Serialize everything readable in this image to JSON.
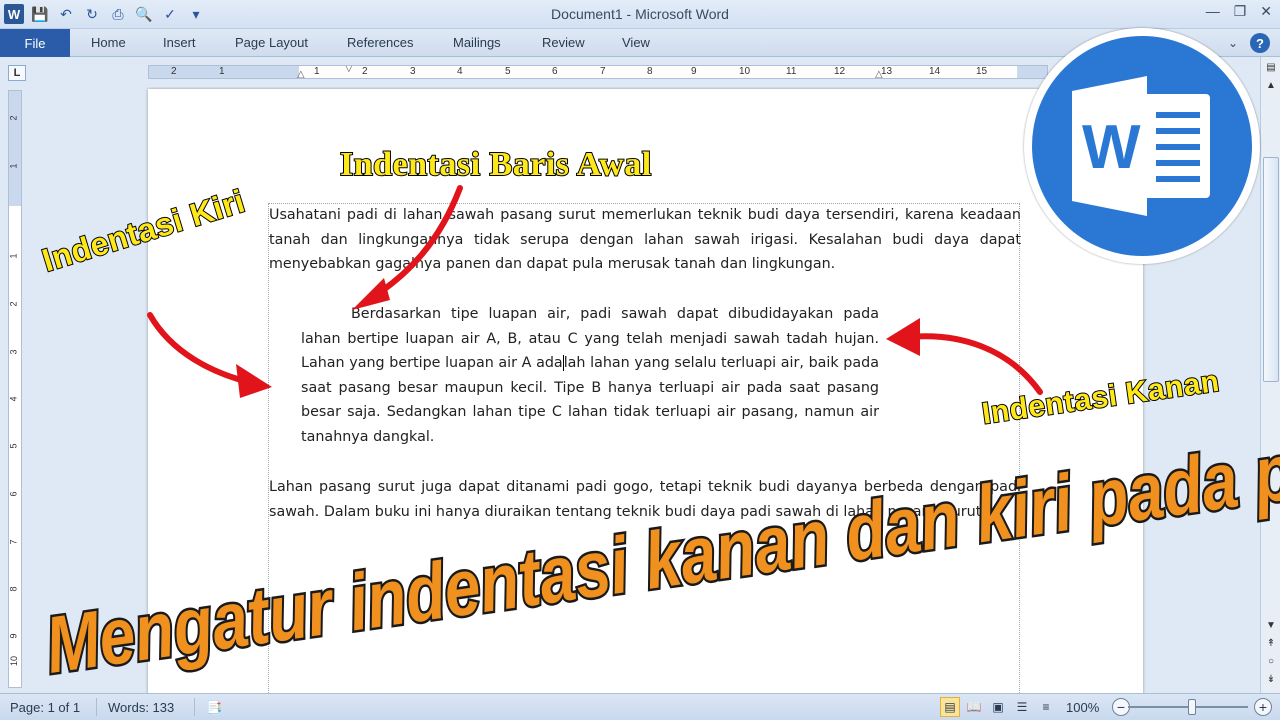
{
  "window": {
    "title": "Document1 - Microsoft Word",
    "app_icon": "W"
  },
  "ribbon": {
    "file": "File",
    "tabs": [
      "Home",
      "Insert",
      "Page Layout",
      "References",
      "Mailings",
      "Review",
      "View"
    ],
    "help": "?"
  },
  "ruler": {
    "tab_selector": "L",
    "h_numbers": [
      "2",
      "1",
      "1",
      "2",
      "3",
      "4",
      "5",
      "6",
      "7",
      "8",
      "9",
      "10",
      "11",
      "12",
      "13",
      "14",
      "15"
    ],
    "v_numbers": [
      "2",
      "1",
      "1",
      "2",
      "3",
      "4",
      "5",
      "6",
      "7",
      "8",
      "9",
      "10"
    ]
  },
  "document": {
    "p1": "Usahatani padi di lahan sawah pasang surut memerlukan teknik budi daya tersendiri, karena keadaan tanah dan lingkungannya tidak serupa dengan lahan sawah irigasi. Kesalahan budi daya dapat menyebabkan gagalnya panen dan dapat pula merusak tanah dan lingkungan.",
    "p2a": "Berdasarkan tipe luapan air, padi sawah dapat dibudidayakan pada lahan bertipe luapan air A, B, atau C yang telah menjadi sawah tadah hujan. Lahan yang bertipe luapan air A ada",
    "p2b": "lah lahan yang selalu terluapi air, baik pada saat pasang besar maupun kecil. Tipe B hanya terluapi air pada saat pasang besar saja. Sedangkan lahan tipe C lahan tidak terluapi air pasang, namun air tanahnya dangkal.",
    "p3": "Lahan pasang surut juga dapat ditanami padi gogo, tetapi teknik budi dayanya berbeda dengan padi sawah. Dalam buku ini hanya diuraikan tentang teknik budi daya padi sawah di lahan pasang surut."
  },
  "status": {
    "page": "Page: 1 of 1",
    "words": "Words: 133",
    "zoom": "100%",
    "zoom_out": "−",
    "zoom_in": "+"
  },
  "annotations": {
    "baris_awal": "Indentasi Baris Awal",
    "kiri": "Indentasi Kiri",
    "kanan": "Indentasi Kanan",
    "title": "Mengatur indentasi kanan dan kiri pada paragraf"
  },
  "logo": {
    "letter": "W",
    "color": "#2b78d4"
  },
  "colors": {
    "arrow": "#e0141a",
    "file_tab": "#2a5caa",
    "annotation_yellow": "#ffe81a",
    "title_orange": "#f0901e"
  }
}
